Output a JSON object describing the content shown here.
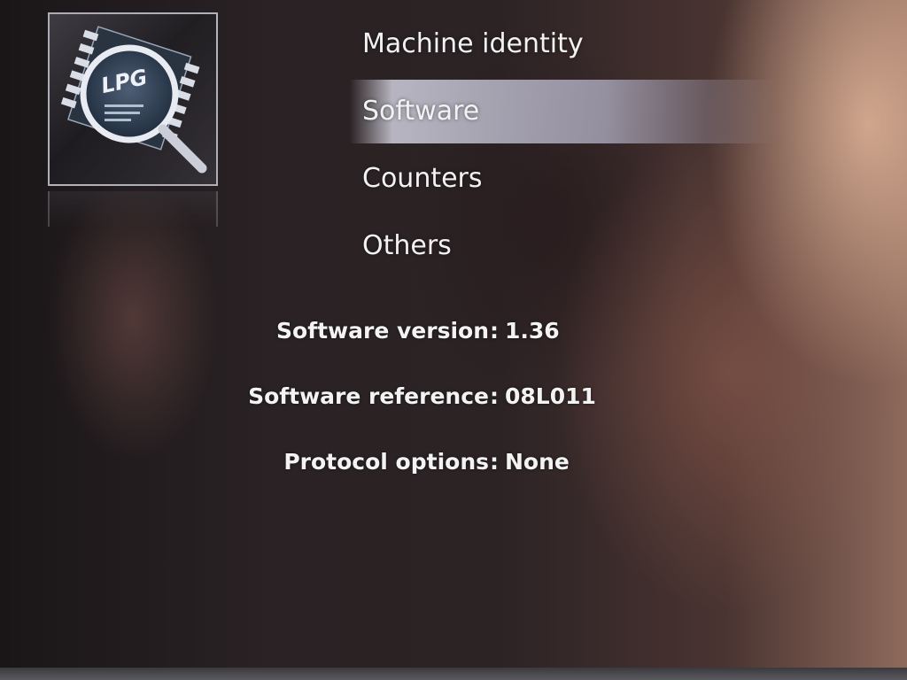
{
  "menu": {
    "items": [
      {
        "label": "Machine identity",
        "selected": false
      },
      {
        "label": "Software",
        "selected": true
      },
      {
        "label": "Counters",
        "selected": false
      },
      {
        "label": "Others",
        "selected": false
      }
    ]
  },
  "logo": {
    "icon": "chip-magnifier-icon",
    "text": "LPG"
  },
  "info": {
    "rows": [
      {
        "label": "Software version",
        "separator": ":",
        "value": "1.36"
      },
      {
        "label": "Software reference",
        "separator": ":",
        "value": "08L011"
      },
      {
        "label": "Protocol options",
        "separator": ":",
        "value": "None"
      }
    ]
  },
  "colors": {
    "text": "#f2f2f2",
    "highlight": "#d8d8ea"
  }
}
